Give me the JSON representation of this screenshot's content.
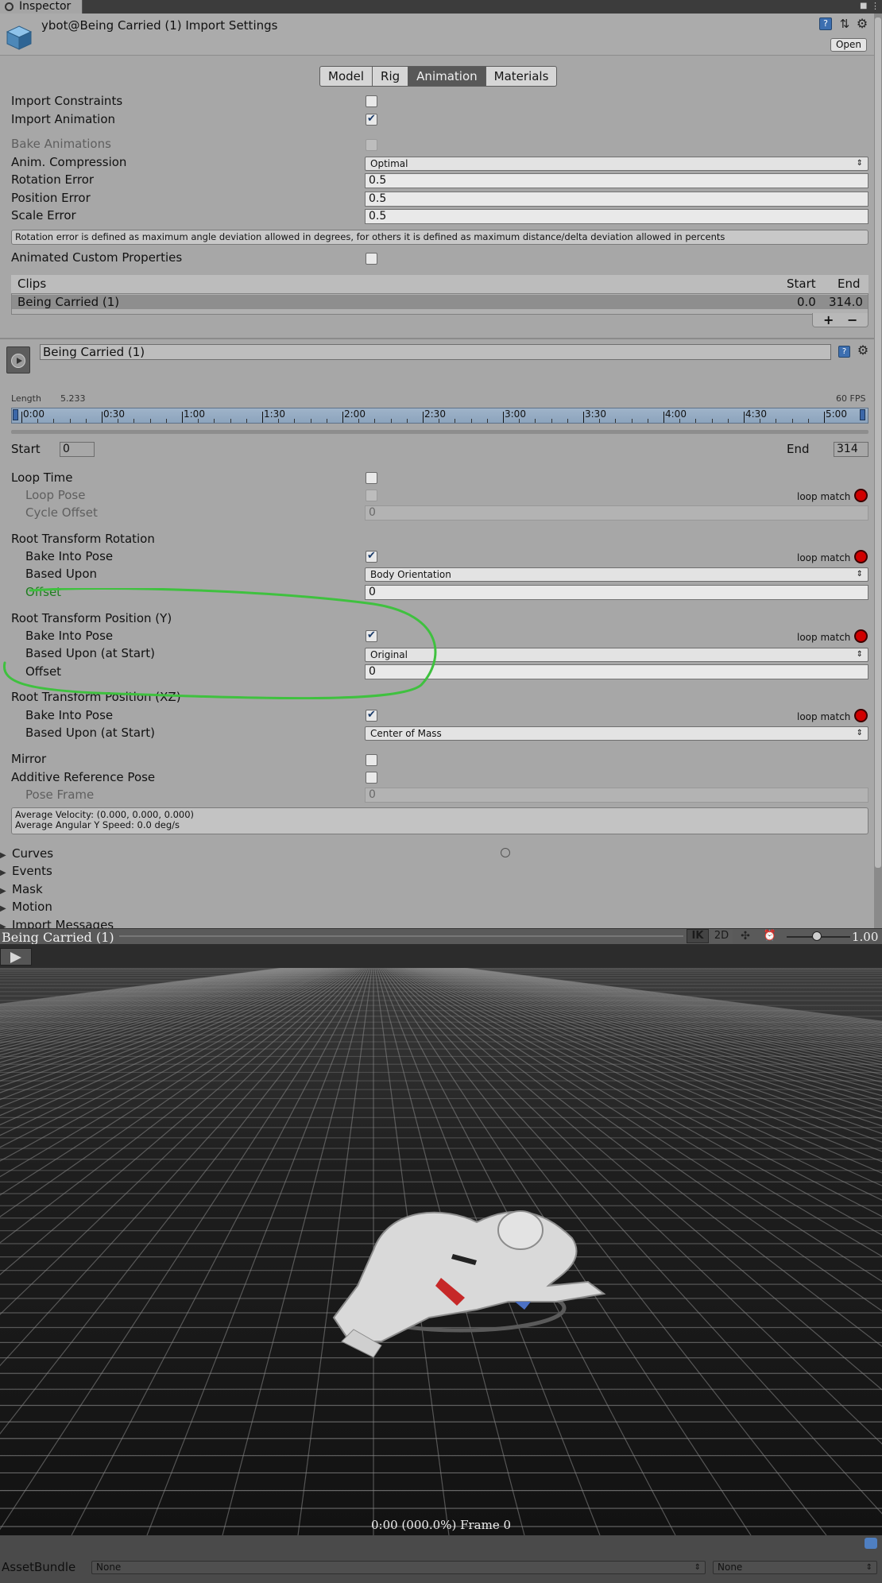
{
  "window": {
    "tab_label": "Inspector"
  },
  "header": {
    "title": "ybot@Being Carried (1) Import Settings",
    "open_label": "Open"
  },
  "tabs": [
    {
      "label": "Model",
      "active": false
    },
    {
      "label": "Rig",
      "active": false
    },
    {
      "label": "Animation",
      "active": true
    },
    {
      "label": "Materials",
      "active": false
    }
  ],
  "import": {
    "import_constraints": {
      "label": "Import Constraints",
      "checked": false
    },
    "import_animation": {
      "label": "Import Animation",
      "checked": true
    },
    "bake_animations": {
      "label": "Bake Animations",
      "checked": false
    },
    "anim_compression": {
      "label": "Anim. Compression",
      "value": "Optimal"
    },
    "rotation_error": {
      "label": "Rotation Error",
      "value": "0.5"
    },
    "position_error": {
      "label": "Position Error",
      "value": "0.5"
    },
    "scale_error": {
      "label": "Scale Error",
      "value": "0.5"
    },
    "info": "Rotation error is defined as maximum angle deviation allowed in degrees, for others it is defined as maximum distance/delta deviation allowed in percents",
    "animated_custom_properties": {
      "label": "Animated Custom Properties",
      "checked": false
    }
  },
  "clips": {
    "header": "Clips",
    "col_start": "Start",
    "col_end": "End",
    "rows": [
      {
        "name": "Being Carried (1)",
        "start": "0.0",
        "end": "314.0"
      }
    ],
    "add_label": "+",
    "remove_label": "−"
  },
  "clip": {
    "name": "Being Carried (1)",
    "length_label": "Length",
    "length_value": "5.233",
    "fps": "60 FPS",
    "ticks": [
      "0:00",
      "0:30",
      "1:00",
      "1:30",
      "2:00",
      "2:30",
      "3:00",
      "3:30",
      "4:00",
      "4:30",
      "5:00"
    ],
    "start_label": "Start",
    "start_value": "0",
    "end_label": "End",
    "end_value": "314"
  },
  "loop": {
    "loop_time": {
      "label": "Loop Time",
      "checked": false
    },
    "loop_pose": {
      "label": "Loop Pose",
      "checked": false,
      "match": "loop match"
    },
    "cycle_offset": {
      "label": "Cycle Offset",
      "value": "0"
    }
  },
  "root_rotation": {
    "title": "Root Transform Rotation",
    "bake": {
      "label": "Bake Into Pose",
      "checked": true,
      "match": "loop match"
    },
    "based_upon": {
      "label": "Based Upon",
      "value": "Body Orientation"
    },
    "offset": {
      "label": "Offset",
      "value": "0"
    }
  },
  "root_position_y": {
    "title": "Root Transform Position (Y)",
    "bake": {
      "label": "Bake Into Pose",
      "checked": true,
      "match": "loop match"
    },
    "based_upon": {
      "label": "Based Upon (at Start)",
      "value": "Original"
    },
    "offset": {
      "label": "Offset",
      "value": "0"
    }
  },
  "root_position_xz": {
    "title": "Root Transform Position (XZ)",
    "bake": {
      "label": "Bake Into Pose",
      "checked": true,
      "match": "loop match"
    },
    "based_upon": {
      "label": "Based Upon (at Start)",
      "value": "Center of Mass"
    }
  },
  "mirror": {
    "label": "Mirror",
    "checked": false
  },
  "additive": {
    "label": "Additive Reference Pose",
    "checked": false
  },
  "pose_frame": {
    "label": "Pose Frame",
    "value": "0"
  },
  "summary": {
    "velocity": "Average Velocity: (0.000, 0.000, 0.000)",
    "angular": "Average Angular Y Speed: 0.0 deg/s"
  },
  "foldouts": [
    "Curves",
    "Events",
    "Mask",
    "Motion",
    "Import Messages"
  ],
  "preview": {
    "clip_name": "Being Carried (1)",
    "ik_label": "IK",
    "twod_label": "2D",
    "speed": "1.00",
    "frame_readout": "0:00 (000.0%) Frame 0"
  },
  "assetbundle": {
    "label": "AssetBundle",
    "bundle": "None",
    "variant": "None"
  },
  "colors": {
    "panel": "#a7a7a7",
    "active_tab": "#585858",
    "loop_match_light": "#d00000",
    "annotation": "#3fc13f",
    "timeline": "#9fb3c9"
  }
}
